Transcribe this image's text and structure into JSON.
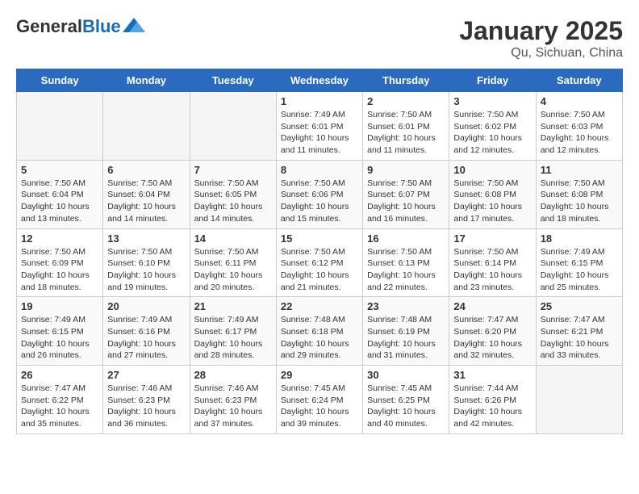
{
  "header": {
    "logo_general": "General",
    "logo_blue": "Blue",
    "title": "January 2025",
    "subtitle": "Qu, Sichuan, China"
  },
  "weekdays": [
    "Sunday",
    "Monday",
    "Tuesday",
    "Wednesday",
    "Thursday",
    "Friday",
    "Saturday"
  ],
  "weeks": [
    [
      {
        "day": "",
        "info": ""
      },
      {
        "day": "",
        "info": ""
      },
      {
        "day": "",
        "info": ""
      },
      {
        "day": "1",
        "info": "Sunrise: 7:49 AM\nSunset: 6:01 PM\nDaylight: 10 hours and 11 minutes."
      },
      {
        "day": "2",
        "info": "Sunrise: 7:50 AM\nSunset: 6:01 PM\nDaylight: 10 hours and 11 minutes."
      },
      {
        "day": "3",
        "info": "Sunrise: 7:50 AM\nSunset: 6:02 PM\nDaylight: 10 hours and 12 minutes."
      },
      {
        "day": "4",
        "info": "Sunrise: 7:50 AM\nSunset: 6:03 PM\nDaylight: 10 hours and 12 minutes."
      }
    ],
    [
      {
        "day": "5",
        "info": "Sunrise: 7:50 AM\nSunset: 6:04 PM\nDaylight: 10 hours and 13 minutes."
      },
      {
        "day": "6",
        "info": "Sunrise: 7:50 AM\nSunset: 6:04 PM\nDaylight: 10 hours and 14 minutes."
      },
      {
        "day": "7",
        "info": "Sunrise: 7:50 AM\nSunset: 6:05 PM\nDaylight: 10 hours and 14 minutes."
      },
      {
        "day": "8",
        "info": "Sunrise: 7:50 AM\nSunset: 6:06 PM\nDaylight: 10 hours and 15 minutes."
      },
      {
        "day": "9",
        "info": "Sunrise: 7:50 AM\nSunset: 6:07 PM\nDaylight: 10 hours and 16 minutes."
      },
      {
        "day": "10",
        "info": "Sunrise: 7:50 AM\nSunset: 6:08 PM\nDaylight: 10 hours and 17 minutes."
      },
      {
        "day": "11",
        "info": "Sunrise: 7:50 AM\nSunset: 6:08 PM\nDaylight: 10 hours and 18 minutes."
      }
    ],
    [
      {
        "day": "12",
        "info": "Sunrise: 7:50 AM\nSunset: 6:09 PM\nDaylight: 10 hours and 18 minutes."
      },
      {
        "day": "13",
        "info": "Sunrise: 7:50 AM\nSunset: 6:10 PM\nDaylight: 10 hours and 19 minutes."
      },
      {
        "day": "14",
        "info": "Sunrise: 7:50 AM\nSunset: 6:11 PM\nDaylight: 10 hours and 20 minutes."
      },
      {
        "day": "15",
        "info": "Sunrise: 7:50 AM\nSunset: 6:12 PM\nDaylight: 10 hours and 21 minutes."
      },
      {
        "day": "16",
        "info": "Sunrise: 7:50 AM\nSunset: 6:13 PM\nDaylight: 10 hours and 22 minutes."
      },
      {
        "day": "17",
        "info": "Sunrise: 7:50 AM\nSunset: 6:14 PM\nDaylight: 10 hours and 23 minutes."
      },
      {
        "day": "18",
        "info": "Sunrise: 7:49 AM\nSunset: 6:15 PM\nDaylight: 10 hours and 25 minutes."
      }
    ],
    [
      {
        "day": "19",
        "info": "Sunrise: 7:49 AM\nSunset: 6:15 PM\nDaylight: 10 hours and 26 minutes."
      },
      {
        "day": "20",
        "info": "Sunrise: 7:49 AM\nSunset: 6:16 PM\nDaylight: 10 hours and 27 minutes."
      },
      {
        "day": "21",
        "info": "Sunrise: 7:49 AM\nSunset: 6:17 PM\nDaylight: 10 hours and 28 minutes."
      },
      {
        "day": "22",
        "info": "Sunrise: 7:48 AM\nSunset: 6:18 PM\nDaylight: 10 hours and 29 minutes."
      },
      {
        "day": "23",
        "info": "Sunrise: 7:48 AM\nSunset: 6:19 PM\nDaylight: 10 hours and 31 minutes."
      },
      {
        "day": "24",
        "info": "Sunrise: 7:47 AM\nSunset: 6:20 PM\nDaylight: 10 hours and 32 minutes."
      },
      {
        "day": "25",
        "info": "Sunrise: 7:47 AM\nSunset: 6:21 PM\nDaylight: 10 hours and 33 minutes."
      }
    ],
    [
      {
        "day": "26",
        "info": "Sunrise: 7:47 AM\nSunset: 6:22 PM\nDaylight: 10 hours and 35 minutes."
      },
      {
        "day": "27",
        "info": "Sunrise: 7:46 AM\nSunset: 6:23 PM\nDaylight: 10 hours and 36 minutes."
      },
      {
        "day": "28",
        "info": "Sunrise: 7:46 AM\nSunset: 6:23 PM\nDaylight: 10 hours and 37 minutes."
      },
      {
        "day": "29",
        "info": "Sunrise: 7:45 AM\nSunset: 6:24 PM\nDaylight: 10 hours and 39 minutes."
      },
      {
        "day": "30",
        "info": "Sunrise: 7:45 AM\nSunset: 6:25 PM\nDaylight: 10 hours and 40 minutes."
      },
      {
        "day": "31",
        "info": "Sunrise: 7:44 AM\nSunset: 6:26 PM\nDaylight: 10 hours and 42 minutes."
      },
      {
        "day": "",
        "info": ""
      }
    ]
  ]
}
